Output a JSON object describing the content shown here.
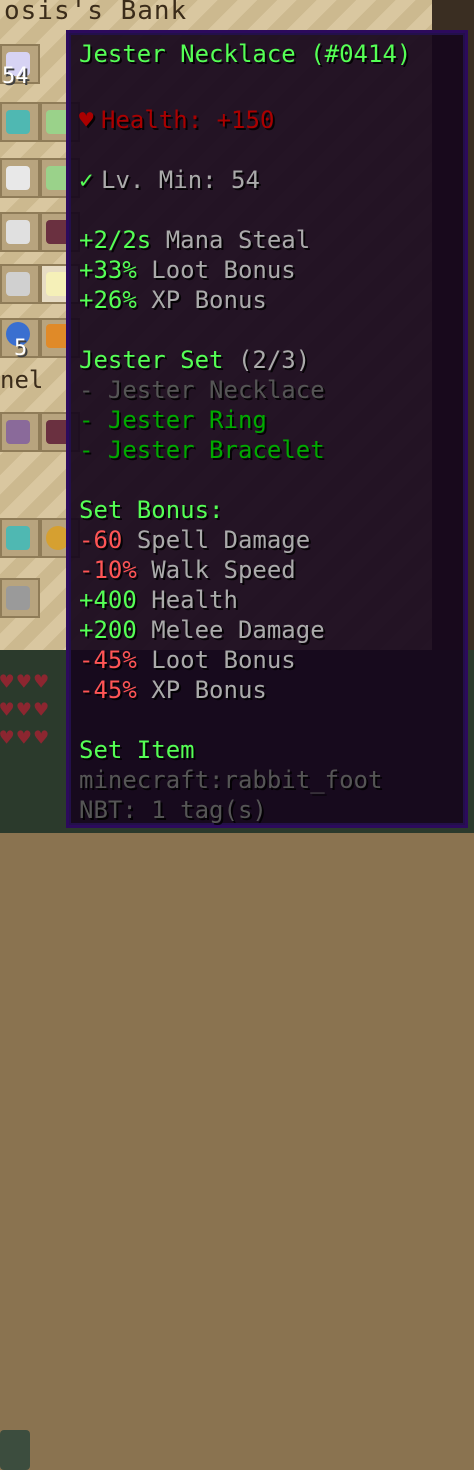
{
  "inventory": {
    "title": "osis's Bank",
    "side_label": "nel",
    "counts": [
      "54",
      "5"
    ]
  },
  "tooltip": {
    "name": "Jester Necklace",
    "id": "(#0414)",
    "health": {
      "icon": "heart-icon",
      "text": "Health: +150"
    },
    "level": {
      "icon": "check-icon",
      "text": "Lv. Min: 54"
    },
    "ids": [
      {
        "value": "+2/2s",
        "label": "Mana Steal"
      },
      {
        "value": "+33%",
        "label": "Loot Bonus"
      },
      {
        "value": "+26%",
        "label": "XP Bonus"
      }
    ],
    "set": {
      "title": "Jester Set",
      "progress": "(2/3)",
      "items": [
        {
          "text": "- Jester Necklace",
          "owned": false
        },
        {
          "text": "- Jester Ring",
          "owned": true
        },
        {
          "text": "- Jester Bracelet",
          "owned": true
        }
      ]
    },
    "set_bonus": {
      "title": "Set Bonus:",
      "entries": [
        {
          "value": "-60",
          "label": "Spell Damage",
          "positive": false
        },
        {
          "value": "-10%",
          "label": "Walk Speed",
          "positive": false
        },
        {
          "value": "+400",
          "label": "Health",
          "positive": true
        },
        {
          "value": "+200",
          "label": "Melee Damage",
          "positive": true
        },
        {
          "value": "-45%",
          "label": "Loot Bonus",
          "positive": false
        },
        {
          "value": "-45%",
          "label": "XP Bonus",
          "positive": false
        }
      ]
    },
    "footer": {
      "set_item": "Set Item",
      "item_id": "minecraft:rabbit_foot",
      "nbt": "NBT: 1 tag(s)"
    },
    "colors": {
      "background": "#16061c",
      "border": "#2c0a5c",
      "green": "#55ff55",
      "red": "#ff5555",
      "dark_red": "#aa0000",
      "gray": "#aaaaaa",
      "dark_gray": "#555555",
      "dark_green": "#00aa00"
    }
  }
}
